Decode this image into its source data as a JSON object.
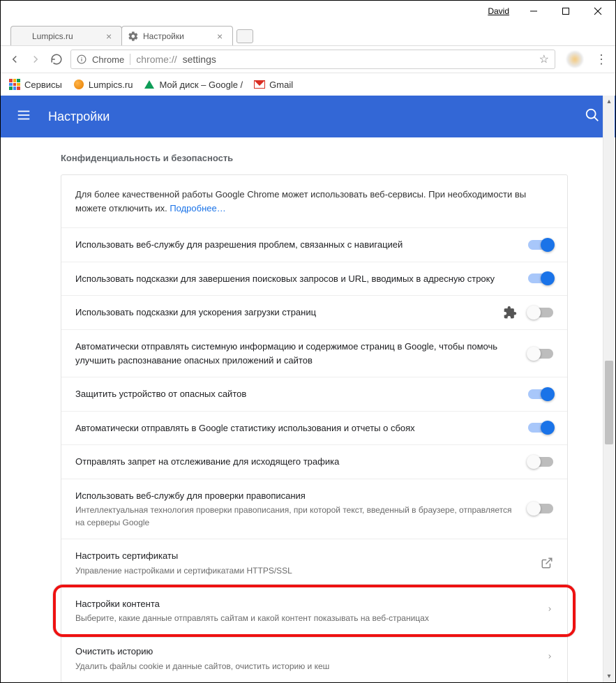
{
  "window": {
    "user": "David"
  },
  "tabs": [
    {
      "title": "Lumpics.ru"
    },
    {
      "title": "Настройки"
    }
  ],
  "addressbar": {
    "secure_label": "Chrome",
    "url_host": "chrome://",
    "url_path": "settings"
  },
  "bookmarks": {
    "apps": "Сервисы",
    "lumpics": "Lumpics.ru",
    "drive": "Мой диск – Google /",
    "gmail": "Gmail"
  },
  "header": {
    "title": "Настройки"
  },
  "section": {
    "title": "Конфиденциальность и безопасность",
    "intro_text": "Для более качественной работы Google Chrome может использовать веб-сервисы. При необходимости вы можете отключить их. ",
    "intro_link": "Подробнее…",
    "rows": [
      {
        "label": "Использовать веб-службу для разрешения проблем, связанных с навигацией",
        "toggle": "on"
      },
      {
        "label": "Использовать подсказки для завершения поисковых запросов и URL, вводимых в адресную строку",
        "toggle": "on"
      },
      {
        "label": "Использовать подсказки для ускорения загрузки страниц",
        "toggle": "off",
        "puzzle": true
      },
      {
        "label": "Автоматически отправлять системную информацию и содержимое страниц в Google, чтобы помочь улучшить распознавание опасных приложений и сайтов",
        "toggle": "off"
      },
      {
        "label": "Защитить устройство от опасных сайтов",
        "toggle": "on"
      },
      {
        "label": "Автоматически отправлять в Google статистику использования и отчеты о сбоях",
        "toggle": "on"
      },
      {
        "label": "Отправлять запрет на отслеживание для исходящего трафика",
        "toggle": "off"
      },
      {
        "label": "Использовать веб-службу для проверки правописания",
        "sub": "Интеллектуальная технология проверки правописания, при которой текст, введенный в браузере, отправляется на серверы Google",
        "toggle": "off"
      },
      {
        "label": "Настроить сертификаты",
        "sub": "Управление настройками и сертификатами HTTPS/SSL",
        "external": true
      },
      {
        "label": "Настройки контента",
        "sub": "Выберите, какие данные отправлять сайтам и какой контент показывать на веб-страницах",
        "chevron": true,
        "highlight": true
      },
      {
        "label": "Очистить историю",
        "sub": "Удалить файлы cookie и данные сайтов, очистить историю и кеш",
        "chevron": true
      }
    ]
  }
}
